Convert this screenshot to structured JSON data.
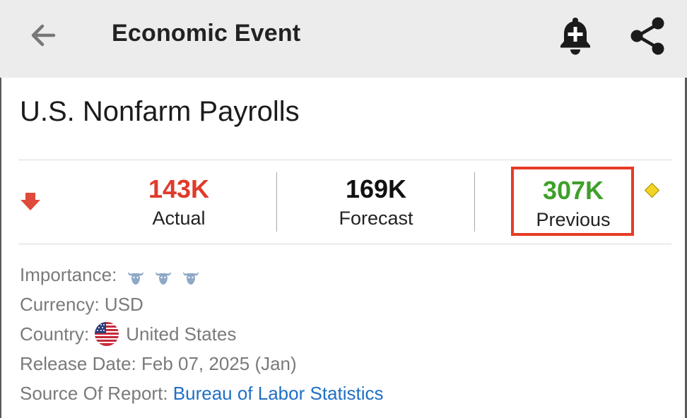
{
  "header": {
    "title": "Economic Event",
    "icons": {
      "back": "arrow-left-icon",
      "alert": "bell-plus-icon",
      "share": "share-icon"
    }
  },
  "event": {
    "title": "U.S. Nonfarm Payrolls",
    "trend_icon": "arrow-down-icon",
    "stats": {
      "actual": {
        "value": "143K",
        "label": "Actual",
        "color": "#e03a2c"
      },
      "forecast": {
        "value": "169K",
        "label": "Forecast",
        "color": "#111111"
      },
      "previous": {
        "value": "307K",
        "label": "Previous",
        "color": "#3fa02a",
        "revised_icon": "diamond-icon"
      }
    },
    "highlight_color": "#e63b26"
  },
  "details": {
    "importance_label": "Importance:",
    "importance_level": 3,
    "importance_icon": "bull-icon",
    "currency": "Currency: USD",
    "country_label": "Country:",
    "country_value": "United States",
    "release_date": "Release Date: Feb 07, 2025 (Jan)",
    "source_label": "Source Of Report:",
    "source_link": "Bureau of Labor Statistics"
  },
  "colors": {
    "accent_link": "#1f6fc5",
    "up_value": "#3fa02a",
    "down_value": "#e03a2c",
    "appbar_bg": "#ececec"
  }
}
